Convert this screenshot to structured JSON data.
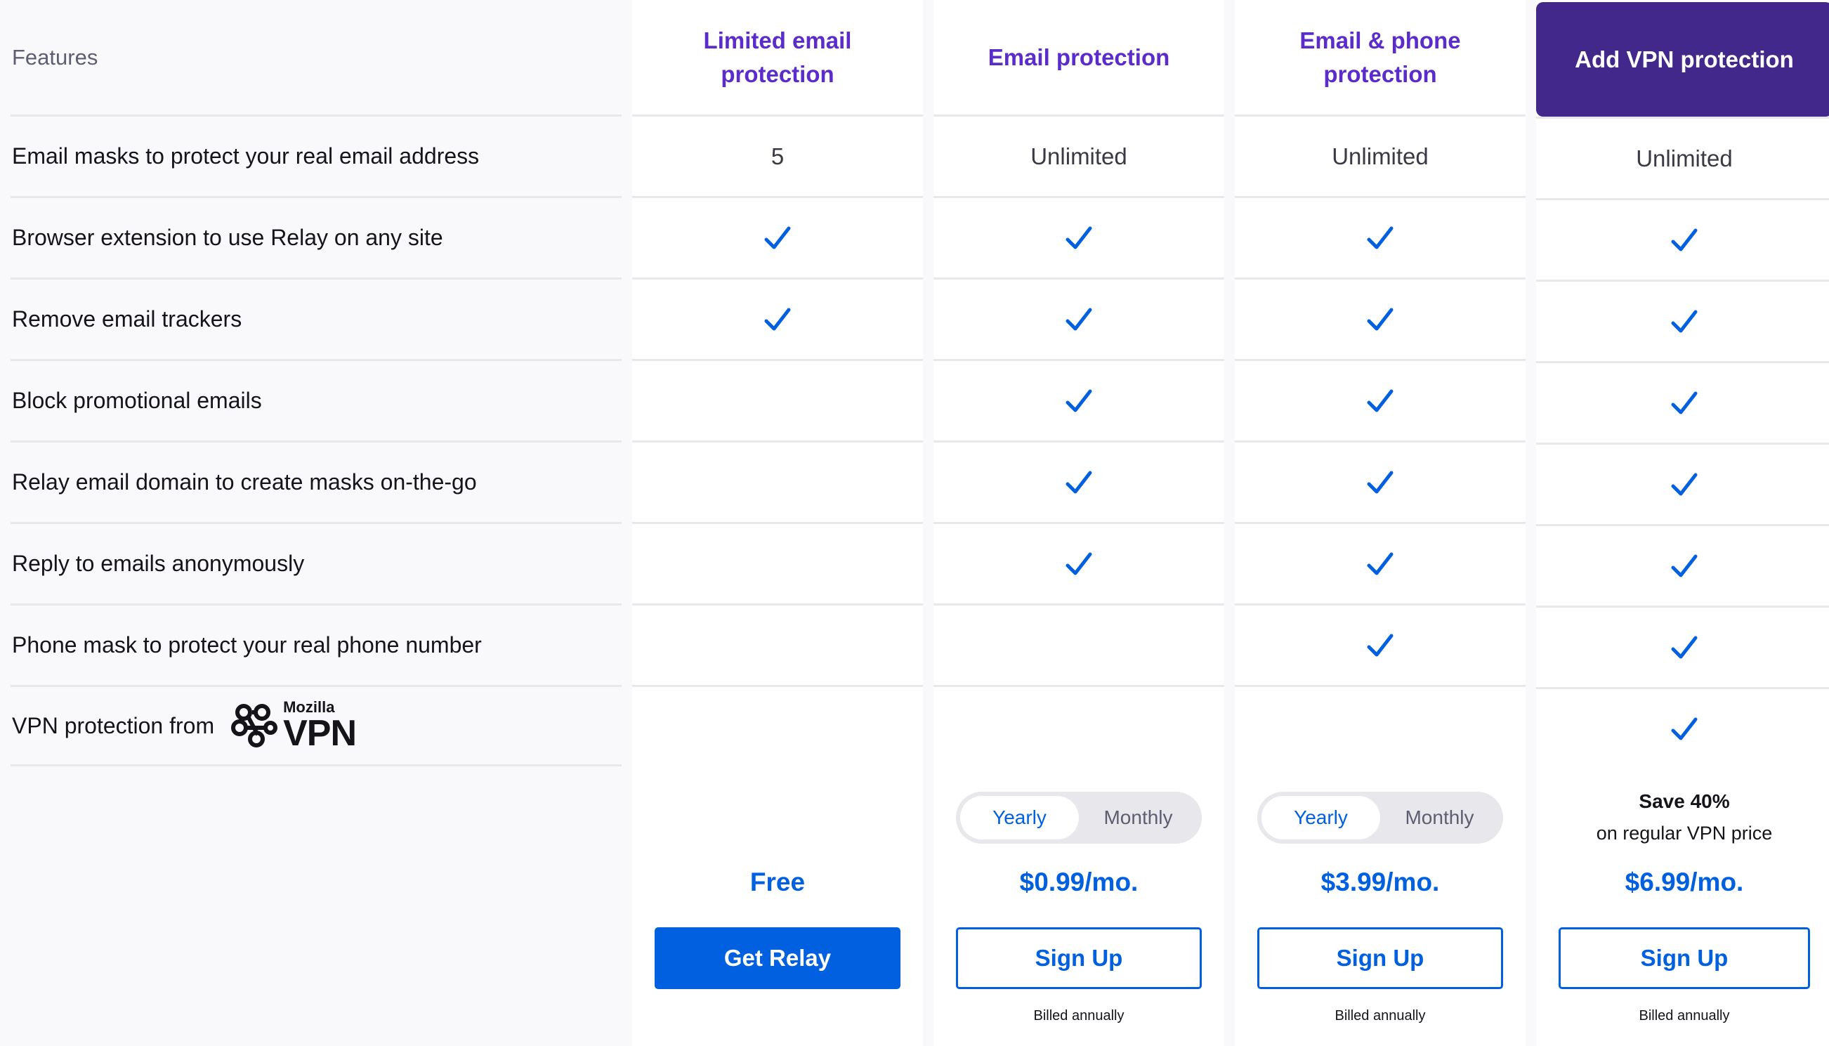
{
  "features_header": "Features",
  "features": [
    "Email masks to protect your real email address",
    "Browser extension to use Relay on any site",
    "Remove email trackers",
    "Block promotional emails",
    "Relay email domain to create masks on-the-go",
    "Reply to emails anonymously",
    "Phone mask to protect your real phone number",
    "VPN protection from"
  ],
  "vpn_logo": {
    "brand": "Mozilla",
    "product": "VPN"
  },
  "plans": [
    {
      "name": "Limited email protection",
      "masks": "5",
      "checks": [
        true,
        true,
        false,
        false,
        false,
        false,
        false
      ],
      "price": "Free",
      "button": "Get Relay"
    },
    {
      "name": "Email protection",
      "masks": "Unlimited",
      "checks": [
        true,
        true,
        true,
        true,
        true,
        false,
        false
      ],
      "toggle": {
        "yearly": "Yearly",
        "monthly": "Monthly",
        "selected": "Yearly"
      },
      "price": "$0.99/mo.",
      "button": "Sign Up",
      "billing": "Billed annually"
    },
    {
      "name": "Email & phone protection",
      "masks": "Unlimited",
      "checks": [
        true,
        true,
        true,
        true,
        true,
        true,
        false
      ],
      "toggle": {
        "yearly": "Yearly",
        "monthly": "Monthly",
        "selected": "Yearly"
      },
      "price": "$3.99/mo.",
      "button": "Sign Up",
      "billing": "Billed annually"
    },
    {
      "name": "Add VPN protection",
      "masks": "Unlimited",
      "checks": [
        true,
        true,
        true,
        true,
        true,
        true,
        true
      ],
      "save_bold": "Save 40%",
      "save_sub": "on regular VPN price",
      "price": "$6.99/mo.",
      "button": "Sign Up",
      "billing": "Billed annually"
    }
  ],
  "colors": {
    "accent": "#0060df",
    "heading": "#5b2ccb",
    "vpn_header_bg": "#42288a"
  },
  "icons": {
    "check": "checkmark-icon",
    "vpn": "mozilla-vpn-logo"
  }
}
